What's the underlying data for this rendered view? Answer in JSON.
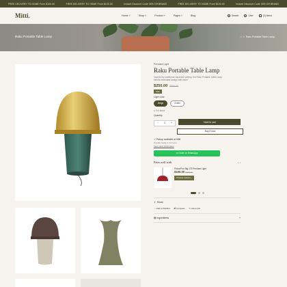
{
  "announcement": {
    "items": [
      "FREE DELIVERY TO HOME From $100.00",
      "FREE DELIVERY TO HOME From $100.00",
      "Instant Discount Code 30% Off BRAND",
      "FREE DELIVERY TO HOME From $100.00",
      "Instant Discount Code 30% Off BRAND"
    ]
  },
  "header": {
    "logo": "Mitti.",
    "nav": [
      "Home",
      "Shop",
      "Product",
      "Pages",
      "Blog"
    ],
    "search": "Search",
    "user": "User",
    "cart": "(0) Items"
  },
  "banner": {
    "title": "Raku Portable Table Lamp",
    "crumb_sep": "»",
    "crumb_current": "Raku Portable Table Lamp"
  },
  "product": {
    "vendor": "Pendant Light",
    "title": "Raku Portable Table Lamp",
    "description": "Inspired by traditional Japanese pottery, the Raku Portable Table Lamp blends minimalist design with warm",
    "price": "$250.00",
    "compare_price": "$300.00",
    "badge": "Sale",
    "option_label": "Light color",
    "options": [
      "Beige",
      "Green"
    ],
    "stock": "9 in stock",
    "quantity_label": "Quantity",
    "quantity": "1",
    "add_to_cart": "Add to cart",
    "buy_now": "Buy it now",
    "pickup": "Pickup available at Mitti",
    "pickup_sub": "Usually ready in 24 hours",
    "store_link": "View store information",
    "whatsapp": "Order on WhatsApp",
    "pairs_title": "Pairs well with",
    "pair_name": "FloronPon Big 175 Pendant Light",
    "pair_price": "$150.00",
    "pair_compare": "$200.00",
    "pair_option": "Choose options",
    "share": "Share",
    "actions": [
      "Add to Wishlist",
      "Compare",
      "Ask a Qst"
    ],
    "ingredients": "Ingredients"
  }
}
